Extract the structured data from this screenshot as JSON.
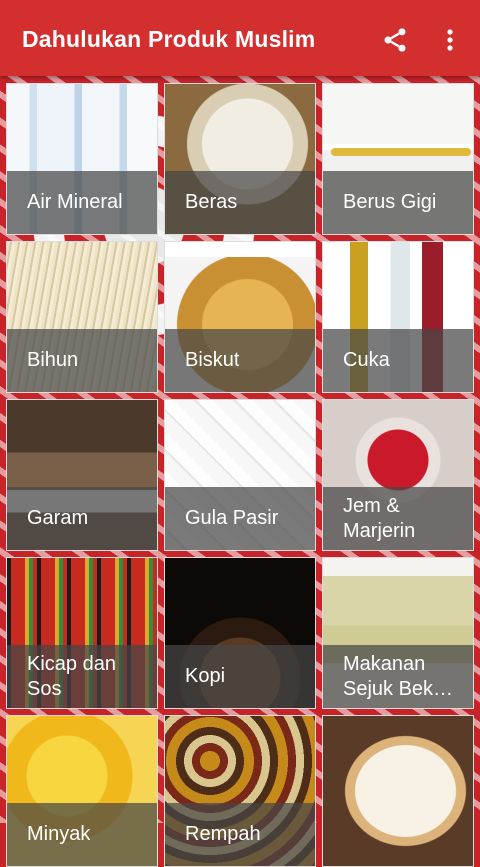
{
  "appbar": {
    "title": "Dahulukan Produk Muslim",
    "share_icon": "share-icon",
    "more_icon": "more-vert-icon",
    "color": "#d32f2f"
  },
  "categories": [
    {
      "label": "Air Mineral",
      "image": "water-bottles"
    },
    {
      "label": "Beras",
      "image": "rice"
    },
    {
      "label": "Berus Gigi",
      "image": "toothbrush"
    },
    {
      "label": "Bihun",
      "image": "vermicelli"
    },
    {
      "label": "Biskut",
      "image": "crackers"
    },
    {
      "label": "Cuka",
      "image": "vinegar-bottles"
    },
    {
      "label": "Garam",
      "image": "salt"
    },
    {
      "label": "Gula Pasir",
      "image": "sugar-cubes"
    },
    {
      "label": "Jem &\nMarjerin",
      "image": "jam-jar"
    },
    {
      "label": "Kicap dan\nSos",
      "image": "sauce-bottles"
    },
    {
      "label": "Kopi",
      "image": "coffee-beans"
    },
    {
      "label": "Makanan\nSejuk Bek…",
      "image": "frozen-food"
    },
    {
      "label": "Minyak",
      "image": "cooking-oil"
    },
    {
      "label": "Rempah",
      "image": "spices"
    },
    {
      "label": "",
      "image": "bread"
    }
  ]
}
